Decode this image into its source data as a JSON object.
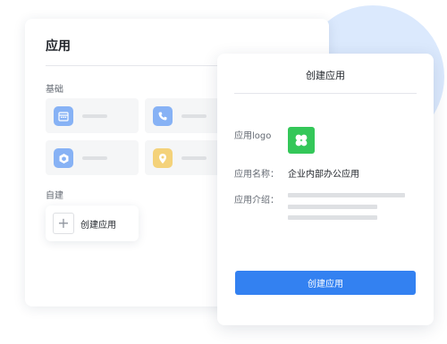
{
  "colors": {
    "accent": "#3381f1",
    "circle": "#dbe9fd",
    "logo_green": "#34c759",
    "calendar_icon": "#87b2f5",
    "phone_icon": "#87b2f5",
    "cube_icon": "#87b2f5",
    "location_icon": "#f4d27a"
  },
  "apps_panel": {
    "title": "应用",
    "basic_section": "基础",
    "basic_tiles": [
      {
        "icon": "calendar-icon"
      },
      {
        "icon": "phone-icon"
      },
      {
        "icon": "cube-icon"
      },
      {
        "icon": "location-pin-icon"
      }
    ],
    "custom_section": "自建",
    "create_tile_label": "创建应用"
  },
  "dialog": {
    "title": "创建应用",
    "logo_label": "应用logo",
    "logo_icon": "four-petal-logo-icon",
    "name_label": "应用名称：",
    "name_value": "企业内部办公应用",
    "desc_label": "应用介绍：",
    "submit_label": "创建应用"
  }
}
